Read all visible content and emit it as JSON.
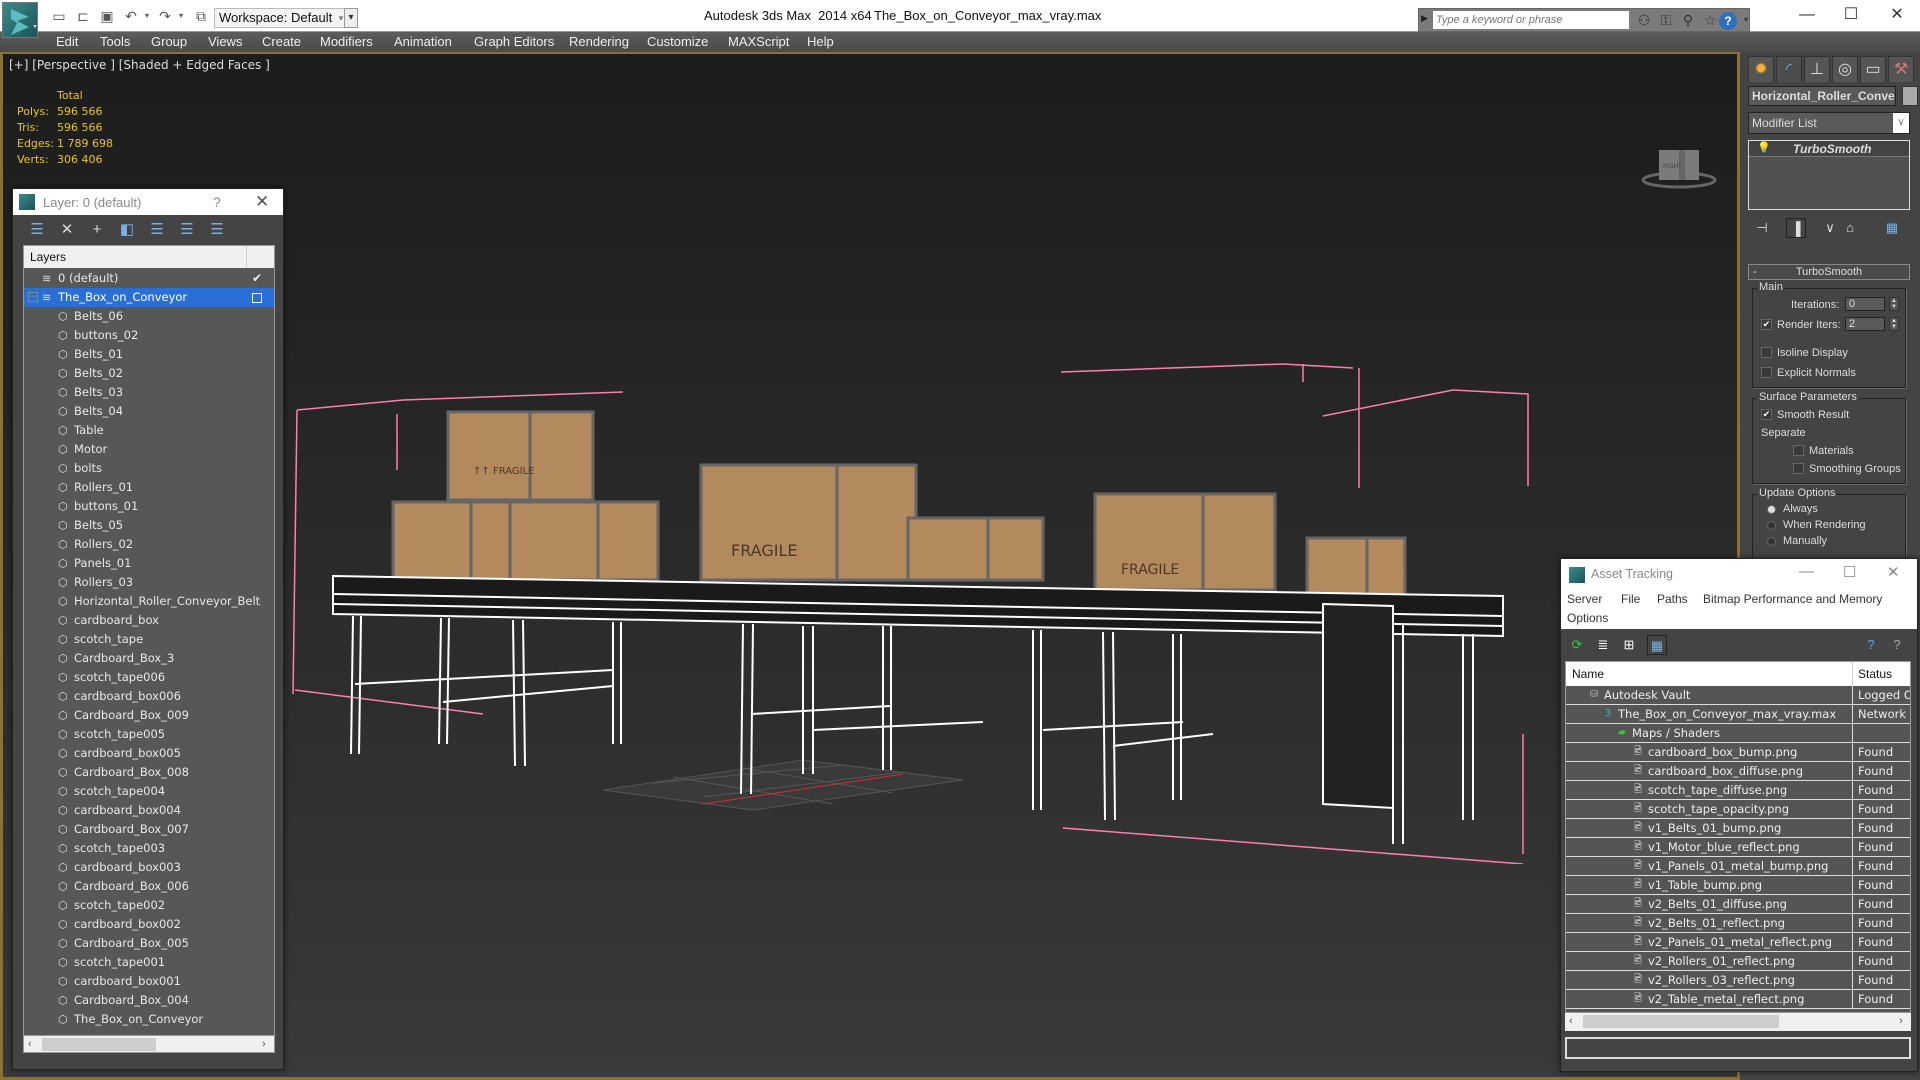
{
  "titlebar": {
    "app_title": "Autodesk 3ds Max  2014 x64",
    "file_title": "The_Box_on_Conveyor_max_vray.max",
    "workspace": "Workspace: Default",
    "search_placeholder": "Type a keyword or phrase",
    "quick_access_icons": [
      "new-file-icon",
      "open-file-icon",
      "save-icon",
      "undo-icon",
      "redo-icon",
      "project-folder-icon"
    ],
    "search_tools": [
      "binoculars-icon",
      "key-icon",
      "satellite-icon",
      "star-icon"
    ],
    "help_label": "?"
  },
  "menu": [
    "Edit",
    "Tools",
    "Group",
    "Views",
    "Create",
    "Modifiers",
    "Animation",
    "Graph Editors",
    "Rendering",
    "Customize",
    "MAXScript",
    "Help"
  ],
  "viewport": {
    "label": "[+] [Perspective ] [Shaded + Edged Faces ]",
    "stats_header": "Total",
    "stats": [
      {
        "key": "Polys:",
        "value": "596 566"
      },
      {
        "key": "Tris:",
        "value": "596 566"
      },
      {
        "key": "Edges:",
        "value": "1 789 698"
      },
      {
        "key": "Verts:",
        "value": "306 406"
      }
    ],
    "viewcube_label": "RIGHT"
  },
  "layer_dialog": {
    "title": "Layer: 0 (default)",
    "help": "?",
    "header": "Layers",
    "layers": [
      {
        "name": "0 (default)",
        "type": "layer",
        "checked": true
      },
      {
        "name": "The_Box_on_Conveyor",
        "type": "layer",
        "selected": true,
        "expanded": true
      }
    ],
    "objects": [
      "Belts_06",
      "buttons_02",
      "Belts_01",
      "Belts_02",
      "Belts_03",
      "Belts_04",
      "Table",
      "Motor",
      "bolts",
      "Rollers_01",
      "buttons_01",
      "Belts_05",
      "Rollers_02",
      "Panels_01",
      "Rollers_03",
      "Horizontal_Roller_Conveyor_Belt",
      "cardboard_box",
      "scotch_tape",
      "Cardboard_Box_3",
      "scotch_tape006",
      "cardboard_box006",
      "Cardboard_Box_009",
      "scotch_tape005",
      "cardboard_box005",
      "Cardboard_Box_008",
      "scotch_tape004",
      "cardboard_box004",
      "Cardboard_Box_007",
      "scotch_tape003",
      "cardboard_box003",
      "Cardboard_Box_006",
      "scotch_tape002",
      "cardboard_box002",
      "Cardboard_Box_005",
      "scotch_tape001",
      "cardboard_box001",
      "Cardboard_Box_004",
      "The_Box_on_Conveyor"
    ]
  },
  "command_panel": {
    "tabs": [
      "create-tab",
      "modify-tab",
      "hierarchy-tab",
      "motion-tab",
      "display-tab",
      "utilities-tab"
    ],
    "object_name": "Horizontal_Roller_Conve",
    "modifier_list": "Modifier List",
    "stack_item": "TurboSmooth",
    "rollout_title": "TurboSmooth",
    "main_group": "Main",
    "iterations_label": "Iterations:",
    "iterations_value": "0",
    "render_iters_label": "Render Iters:",
    "render_iters_value": "2",
    "render_iters_checked": true,
    "isoline_label": "Isoline Display",
    "explicit_normals_label": "Explicit Normals",
    "surface_group": "Surface Parameters",
    "smooth_result_label": "Smooth Result",
    "separate_label": "Separate",
    "materials_label": "Materials",
    "smoothing_groups_label": "Smoothing Groups",
    "update_group": "Update Options",
    "update_options": [
      "Always",
      "When Rendering",
      "Manually"
    ],
    "update_selected": "Always"
  },
  "asset_tracking": {
    "title": "Asset Tracking",
    "menus": [
      "Server",
      "File",
      "Paths",
      "Bitmap Performance and Memory",
      "Options"
    ],
    "col_name": "Name",
    "col_status": "Status",
    "rows": [
      {
        "name": "Autodesk Vault",
        "status": "Logged O",
        "level": 0,
        "icon": "vault-icon"
      },
      {
        "name": "The_Box_on_Conveyor_max_vray.max",
        "status": "Network P",
        "level": 1,
        "icon": "max-file-icon"
      },
      {
        "name": "Maps / Shaders",
        "status": "",
        "level": 2,
        "icon": "maps-icon"
      },
      {
        "name": "cardboard_box_bump.png",
        "status": "Found",
        "level": 3,
        "icon": "bitmap-icon"
      },
      {
        "name": "cardboard_box_diffuse.png",
        "status": "Found",
        "level": 3,
        "icon": "bitmap-icon"
      },
      {
        "name": "scotch_tape_diffuse.png",
        "status": "Found",
        "level": 3,
        "icon": "bitmap-icon"
      },
      {
        "name": "scotch_tape_opacity.png",
        "status": "Found",
        "level": 3,
        "icon": "bitmap-icon"
      },
      {
        "name": "v1_Belts_01_bump.png",
        "status": "Found",
        "level": 3,
        "icon": "bitmap-icon"
      },
      {
        "name": "v1_Motor_blue_reflect.png",
        "status": "Found",
        "level": 3,
        "icon": "bitmap-icon"
      },
      {
        "name": "v1_Panels_01_metal_bump.png",
        "status": "Found",
        "level": 3,
        "icon": "bitmap-icon"
      },
      {
        "name": "v1_Table_bump.png",
        "status": "Found",
        "level": 3,
        "icon": "bitmap-icon"
      },
      {
        "name": "v2_Belts_01_diffuse.png",
        "status": "Found",
        "level": 3,
        "icon": "bitmap-icon"
      },
      {
        "name": "v2_Belts_01_reflect.png",
        "status": "Found",
        "level": 3,
        "icon": "bitmap-icon"
      },
      {
        "name": "v2_Panels_01_metal_reflect.png",
        "status": "Found",
        "level": 3,
        "icon": "bitmap-icon"
      },
      {
        "name": "v2_Rollers_01_reflect.png",
        "status": "Found",
        "level": 3,
        "icon": "bitmap-icon"
      },
      {
        "name": "v2_Rollers_03_reflect.png",
        "status": "Found",
        "level": 3,
        "icon": "bitmap-icon"
      },
      {
        "name": "v2_Table_metal_reflect.png",
        "status": "Found",
        "level": 3,
        "icon": "bitmap-icon"
      }
    ]
  },
  "colors": {
    "stats_text": "#e8c32a",
    "selection": "#2a6fd6",
    "viewport_border": "#8a7230",
    "bbox_lines": "#ff7eb0",
    "box_cardboard": "#b38a5e"
  }
}
